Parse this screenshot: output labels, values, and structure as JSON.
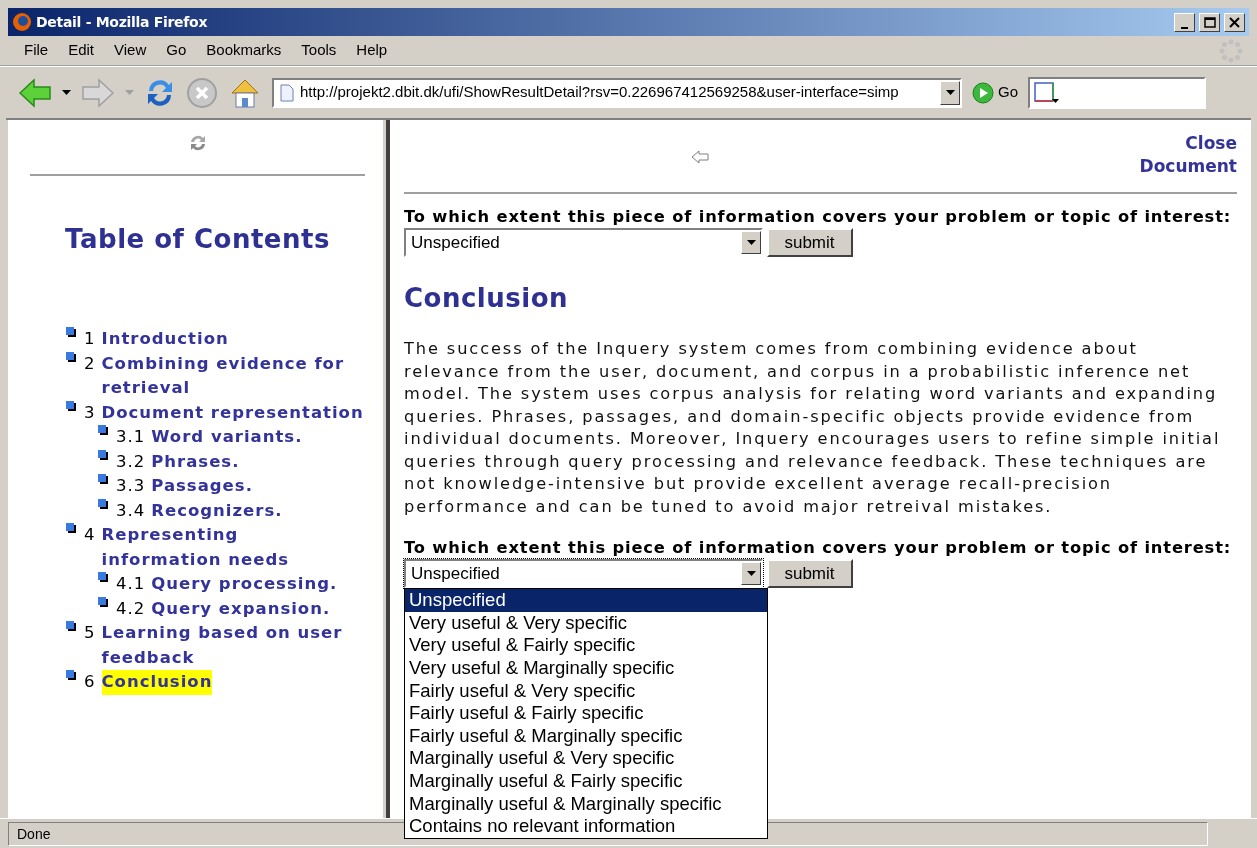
{
  "window": {
    "title": "Detail - Mozilla Firefox"
  },
  "menu": [
    "File",
    "Edit",
    "View",
    "Go",
    "Bookmarks",
    "Tools",
    "Help"
  ],
  "toolbar": {
    "url": "http://projekt2.dbit.dk/ufi/ShowResultDetail?rsv=0.226967412569258&user-interface=simp",
    "go_label": "Go"
  },
  "toc": {
    "title": "Table of Contents",
    "items": [
      {
        "number": "1",
        "title": "Introduction",
        "selected": false
      },
      {
        "number": "2",
        "title": "Combining evidence for retrieval",
        "selected": false
      },
      {
        "number": "3",
        "title": "Document representation",
        "selected": false,
        "children": [
          {
            "number": "3.1",
            "title": "Word variants.",
            "selected": false
          },
          {
            "number": "3.2",
            "title": "Phrases.",
            "selected": false
          },
          {
            "number": "3.3",
            "title": "Passages.",
            "selected": false
          },
          {
            "number": "3.4",
            "title": "Recognizers.",
            "selected": false
          }
        ]
      },
      {
        "number": "4",
        "title": "Representing information needs",
        "selected": false,
        "children": [
          {
            "number": "4.1",
            "title": "Query processing.",
            "selected": false
          },
          {
            "number": "4.2",
            "title": "Query expansion.",
            "selected": false
          }
        ]
      },
      {
        "number": "5",
        "title": "Learning based on user feedback",
        "selected": false
      },
      {
        "number": "6",
        "title": "Conclusion",
        "selected": true
      }
    ]
  },
  "document": {
    "close_link": "Close Document",
    "forms": [
      {
        "question": "To which extent this piece of information covers your problem or topic of interest:",
        "value": "Unspecified",
        "submit": "submit",
        "expanded": false
      },
      {
        "question": "To which extent this piece of information covers your problem or topic of interest:",
        "value": "Unspecified",
        "submit": "submit",
        "expanded": true,
        "options": [
          {
            "label": "Unspecified",
            "selected": true
          },
          {
            "label": "Very useful & Very specific",
            "selected": false
          },
          {
            "label": "Very useful & Fairly specific",
            "selected": false
          },
          {
            "label": "Very useful & Marginally specific",
            "selected": false
          },
          {
            "label": "Fairly useful & Very specific",
            "selected": false
          },
          {
            "label": "Fairly useful & Fairly specific",
            "selected": false
          },
          {
            "label": "Fairly useful & Marginally specific",
            "selected": false
          },
          {
            "label": "Marginally useful & Very specific",
            "selected": false
          },
          {
            "label": "Marginally useful & Fairly specific",
            "selected": false
          },
          {
            "label": "Marginally useful & Marginally specific",
            "selected": false
          },
          {
            "label": "Contains no relevant information",
            "selected": false
          }
        ]
      }
    ],
    "heading": "Conclusion",
    "paragraph": "The success of the Inquery system comes from combining evidence about relevance from the user, document, and corpus in a probabilistic inference net model. The system uses corpus analysis for relating word variants and expanding queries. Phrases, passages, and domain-specific objects provide evidence from individual documents. Moreover, Inquery encourages users to refine simple initial queries through query processing and relevance feedback. These techniques are not knowledge-intensive but provide excellent average recall-precision performance and can be tuned to avoid major retreival mistakes."
  },
  "status_bar": "Done"
}
